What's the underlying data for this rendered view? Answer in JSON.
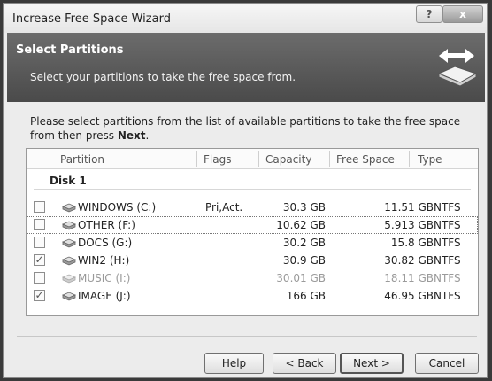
{
  "window": {
    "title": "Increase Free Space Wizard",
    "help_label": "?",
    "close_label": "x"
  },
  "header": {
    "title": "Select Partitions",
    "subtitle": "Select your partitions to take the free space from."
  },
  "instruction": {
    "text": "Please select partitions from the list of available partitions to take the free space from then press ",
    "bold": "Next",
    "end": "."
  },
  "columns": [
    "Partition",
    "Flags",
    "Capacity",
    "Free Space",
    "Type"
  ],
  "group_label": "Disk 1",
  "partitions": [
    {
      "name": "WINDOWS (C:)",
      "flags": "Pri,Act.",
      "capacity": "30.3 GB",
      "free": "11.51 GB",
      "type": "NTFS",
      "checked": false,
      "checkmark": ""
    },
    {
      "name": "OTHER (F:)",
      "flags": "",
      "capacity": "10.62 GB",
      "free": "5.913 GB",
      "type": "NTFS",
      "checked": false,
      "checkmark": ""
    },
    {
      "name": "DOCS (G:)",
      "flags": "",
      "capacity": "30.2 GB",
      "free": "15.8 GB",
      "type": "NTFS",
      "checked": false,
      "checkmark": ""
    },
    {
      "name": "WIN2 (H:)",
      "flags": "",
      "capacity": "30.9 GB",
      "free": "30.82 GB",
      "type": "NTFS",
      "checked": true,
      "checkmark": "✓"
    },
    {
      "name": "MUSIC (I:)",
      "flags": "",
      "capacity": "30.01 GB",
      "free": "18.11 GB",
      "type": "NTFS",
      "checked": false,
      "checkmark": ""
    },
    {
      "name": "IMAGE (J:)",
      "flags": "",
      "capacity": "166 GB",
      "free": "46.95 GB",
      "type": "NTFS",
      "checked": true,
      "checkmark": "✓"
    }
  ],
  "buttons": {
    "help": "Help",
    "back": "< Back",
    "next": "Next >",
    "cancel": "Cancel"
  }
}
